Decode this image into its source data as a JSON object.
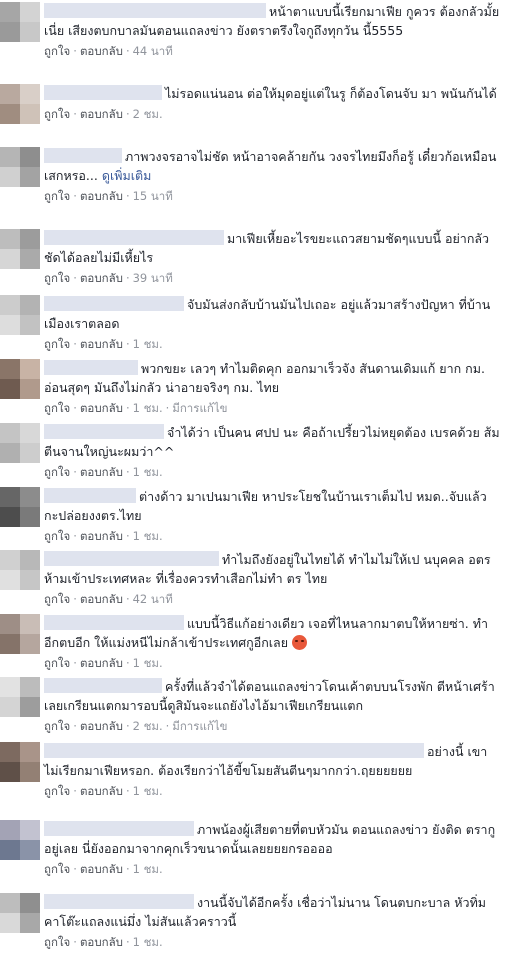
{
  "labels": {
    "like": "ถูกใจ",
    "reply": "ตอบกลับ",
    "edited": "มีการแก้ไข",
    "see_more": "ดูเพิ่มเติม"
  },
  "colors": {
    "text": "#1d2129",
    "link": "#385898",
    "meta": "#90949c",
    "name_blur": "#dfe3ee"
  },
  "comments": [
    {
      "avatar": [
        "#a6a6a6",
        "#d3d3d3",
        "#9a9a9a",
        "#c8c8c8"
      ],
      "text": "หน้าตาแบบนี้เรียกมาเฟีย กูควร ต้องกลัวมั้ยเนี่ย เสียงตบกบาลมันตอนแถลงข่าว ยังตราตรึงใจกูถึงทุกวัน นี้5555",
      "time": "44 นาที",
      "edited": false
    },
    {
      "avatar": [
        "#b9a99f",
        "#d9cfc8",
        "#a08d80",
        "#cfc2b8"
      ],
      "text": "ไม่รอดแน่นอน ต่อให้มุดอยู่แต่ในรู ก็ต้องโดนจับ มา พนันกันได้",
      "time": "2 ชม.",
      "edited": false
    },
    {
      "avatar": [
        "#b5b5b5",
        "#8e8e8e",
        "#d0d0d0",
        "#a3a3a3"
      ],
      "text": "ภาพวงจรอาจไม่ชัด หน้าอาจคล้ายกัน วงจรไทยมึงก็อรู้ เดี๋ยวก้อเหมือนเสกหรอ...",
      "see_more": true,
      "time": "15 นาที",
      "edited": false
    },
    {
      "avatar": [
        "#bdbdbd",
        "#9c9c9c",
        "#d6d6d6",
        "#aaaaaa"
      ],
      "text": "มาเฟียเหี้ยอะไรขยะแถวสยามชัดๆแบบนี้ อย่ากลัวชัดได้อลยไม่มีเหี้ยไร",
      "time": "39 นาที",
      "edited": false
    },
    {
      "avatar": [
        "#cccccc",
        "#b3b3b3",
        "#dddddd",
        "#c2c2c2"
      ],
      "text": "จับมันส่งกลับบ้านมันไปเถอะ อยู่แล้วมาสร้างปัญหา ที่บ้านเมืองเราตลอด",
      "time": "1 ชม.",
      "edited": false
    },
    {
      "avatar": [
        "#8a7568",
        "#c8b3a5",
        "#6f5b50",
        "#b09a8c"
      ],
      "text": "พวกขยะ เลวๆ ทำไมติดคุก ออกมาเร็วจัง สันดานเดิมแก้ ยาก กม. อ่อนสุดๆ มันถึงไม่กลัว น่าอายจริงๆ กม. ไทย",
      "time": "1 ชม.",
      "edited": true
    },
    {
      "avatar": [
        "#c4c4c4",
        "#d8d8d8",
        "#b0b0b0",
        "#cdcdcd"
      ],
      "text": "จำได้ว่า เป็นคน ศปป นะ คือถ้าเปรี้ยวไม่หยุดต้อง เบรคด้วย ส้มตีนจานใหญ่นะผมว่า^^",
      "time": "1 ชม.",
      "edited": false
    },
    {
      "avatar": [
        "#666666",
        "#8c8c8c",
        "#4d4d4d",
        "#7a7a7a"
      ],
      "text": "ต่างด้าว มาเปนมาเฟีย หาประโยชในบ้านเราเต็มไป หมด..จับแล้วกะปล่อยงงตร.ไทย",
      "time": "1 ชม.",
      "edited": false
    },
    {
      "avatar": [
        "#d0d0d0",
        "#b8b8b8",
        "#e0e0e0",
        "#c6c6c6"
      ],
      "text": "ทำไมถึงยังอยู่ในไทยได้ ทำไมไม่ให้เป นบุคคล อตร ห้ามเข้าประเทศหละ ที่เรื่องควรทำเสือกไม่ทำ ตร ไทย",
      "time": "42 นาที",
      "edited": false
    },
    {
      "avatar": [
        "#9e8e86",
        "#c9bdb6",
        "#857369",
        "#b5a69e"
      ],
      "text": "แบบนี้วิธีแก้อย่างเดียว เจอที่ไหนลากมาตบให้หายซ่า. ทำอีกตบอีก ให้แม่งหนีไม่กล้าเข้าประเทศกูอีกเลย",
      "emoji": true,
      "time": "1 ชม.",
      "edited": false
    },
    {
      "avatar": [
        "#e2e2e2",
        "#bcbcbc",
        "#d4d4d4",
        "#9d9d9d"
      ],
      "text": "ครั้งที่แล้วจำได้ตอนแถลงข่าวโดนเค้าตบบนโรงพัก ตีหน้าเศร้าเลยเกรียนแตกมารอบนี้ดูสิมันจะแถยังไงไอ้มาเฟียเกรียนแตก",
      "time": "2 ชม.",
      "edited": true
    },
    {
      "avatar": [
        "#7d6a60",
        "#a99489",
        "#5f5048",
        "#938074"
      ],
      "text": "อย่างนี้ เขาไม่เรียกมาเฟียหรอก. ต้องเรียกว่าไอ้ขี้ขโมยสันตีนๆมากกว่า.ฤยยยยยย",
      "time": "1 ชม.",
      "edited": false
    },
    {
      "avatar": [
        "#a3a3b5",
        "#c2c2d0",
        "#6d7890",
        "#8a93a8"
      ],
      "text": "ภาพน้องผู้เสียตายที่ตบหัวมัน ตอนแถลงข่าว ยังติด ตรากูอยู่เลย นี่ยังออกมาจากคุกเร็วขนาดนั้นเลยยยยกรออออ",
      "time": "1 ชม.",
      "edited": false
    },
    {
      "avatar": [
        "#bdbdbd",
        "#8f8f8f",
        "#d9d9d9",
        "#a8a8a8"
      ],
      "text": "งานนี้จับได้อีกครั้ง เชื่อว่าไม่นาน โดนตบกะบาล หัวทิ่มคาโต๊ะแถลงแน่มึ่ง ไม่สันแล้วคราวนี้",
      "time": "1 ชม.",
      "edited": false
    }
  ]
}
